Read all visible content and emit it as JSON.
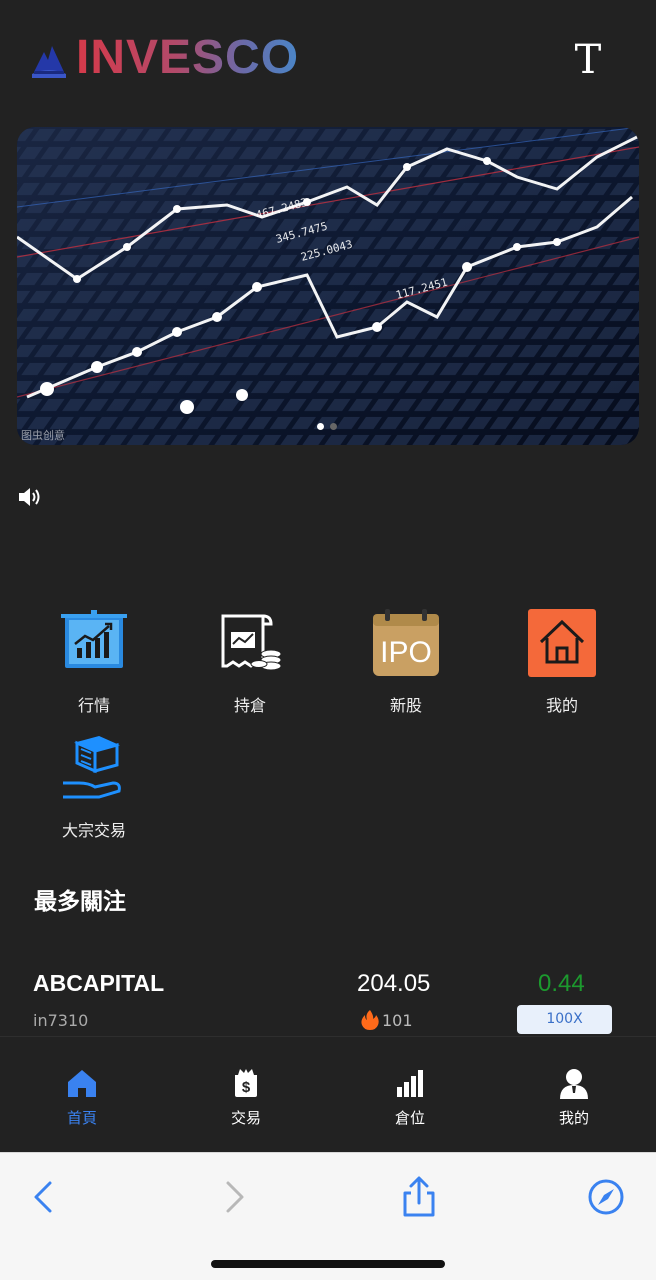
{
  "header": {
    "logo_text": "INVESCO",
    "font_toggle": "T"
  },
  "banner": {
    "credit": "图虫创意",
    "slides": 2,
    "active_slide": 1
  },
  "menu": [
    {
      "label": "行情",
      "icon": "market-chart-icon"
    },
    {
      "label": "持倉",
      "icon": "holdings-receipt-icon"
    },
    {
      "label": "新股",
      "icon": "ipo-calendar-icon"
    },
    {
      "label": "我的",
      "icon": "home-icon"
    },
    {
      "label": "大宗交易",
      "icon": "block-trade-icon"
    }
  ],
  "ipo_icon_text": "IPO",
  "section": {
    "title": "最多關注"
  },
  "stocks": [
    {
      "name": "ABCAPITAL",
      "code": "in7310",
      "price": "204.05",
      "heat": "101",
      "change": "0.44",
      "leverage": "100X"
    }
  ],
  "tabbar": [
    {
      "label": "首頁",
      "icon": "home-tab-icon",
      "active": true
    },
    {
      "label": "交易",
      "icon": "trade-bag-icon",
      "active": false
    },
    {
      "label": "倉位",
      "icon": "position-bars-icon",
      "active": false
    },
    {
      "label": "我的",
      "icon": "user-icon",
      "active": false
    }
  ],
  "colors": {
    "background": "#222222",
    "accent_blue": "#3a82f0",
    "up_green": "#1c9a2e",
    "heat_orange": "#ff6a1a",
    "ipo_gold": "#c9a063",
    "home_orange": "#f4693a"
  }
}
